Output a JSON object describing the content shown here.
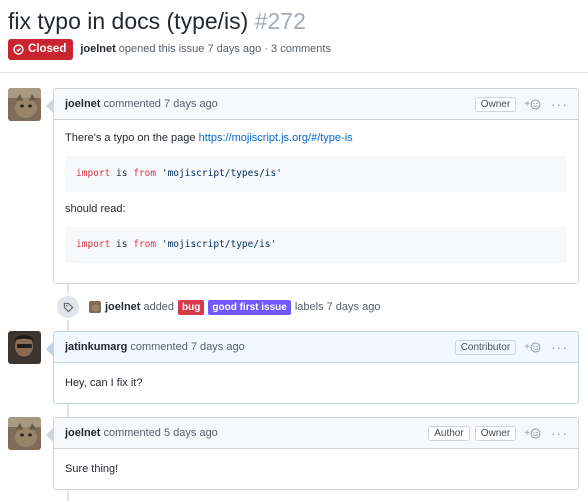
{
  "issue": {
    "title": "fix typo in docs (type/is)",
    "number": "#272",
    "state": "Closed",
    "author": "joelnet",
    "meta": "opened this issue 7 days ago · 3 comments"
  },
  "comments": [
    {
      "author": "joelnet",
      "action": "commented 7 days ago",
      "roles": [
        "Owner"
      ],
      "body_text1": "There's a typo on the page ",
      "link": "https://mojiscript.js.org/#/type-is",
      "code1": {
        "kw1": "import",
        "mid": " is ",
        "kw2": "from",
        "str": "'mojiscript/types/is'"
      },
      "body_text2": "should read:",
      "code2": {
        "kw1": "import",
        "mid": " is ",
        "kw2": "from",
        "str": "'mojiscript/type/is'"
      }
    },
    {
      "author": "jatinkumarg",
      "action": "commented 7 days ago",
      "roles": [
        "Contributor"
      ],
      "body": "Hey, can I fix it?"
    },
    {
      "author": "joelnet",
      "action": "commented 5 days ago",
      "roles": [
        "Author",
        "Owner"
      ],
      "body": "Sure thing!"
    }
  ],
  "event": {
    "actor": "joelnet",
    "verb": "added",
    "labels": [
      {
        "name": "bug",
        "color": "#d73a4a"
      },
      {
        "name": "good first issue",
        "color": "#7057ff"
      }
    ],
    "suffix": "labels 7 days ago"
  },
  "colors": {
    "closed": "#cb2431",
    "link": "#0366d6",
    "highlight_border": "#c0d3eb"
  },
  "icons": [
    "issue-closed-icon",
    "smiley-icon",
    "kebab-icon",
    "tag-icon"
  ]
}
